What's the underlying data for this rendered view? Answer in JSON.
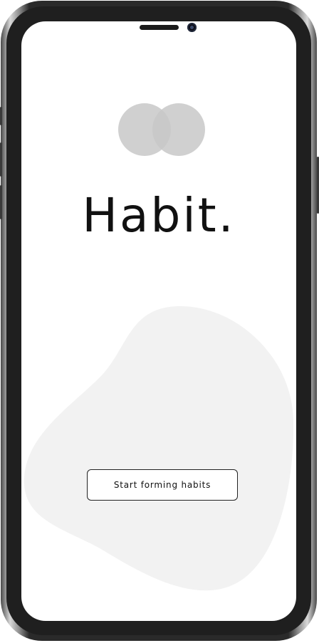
{
  "app": {
    "title": "Habit."
  },
  "welcome": {
    "cta_label": "Start forming habits"
  },
  "icons": {
    "logo": "overlapping-circles-icon",
    "camera": "front-camera-icon"
  },
  "colors": {
    "screen_background": "#ffffff",
    "logo_circle": "#c8c8c8",
    "logo_overlap": "#a9a9a9",
    "blob": "#f2f2f2",
    "title_text": "#111111",
    "button_border": "#222222",
    "phone_bezel": "#1f1f1f"
  }
}
